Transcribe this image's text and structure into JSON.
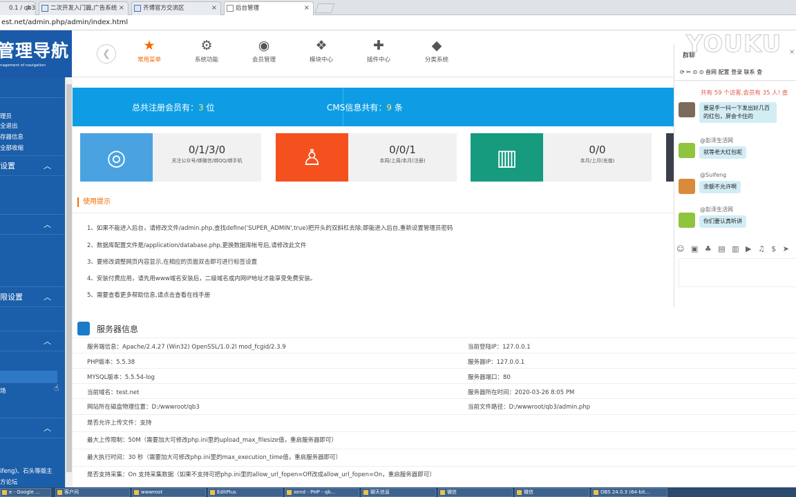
{
  "browser": {
    "tabs": [
      {
        "label": "0.1 / qb3"
      },
      {
        "label": "二次开发入门篇,广告系统"
      },
      {
        "label": "齐博官方交流区"
      },
      {
        "label": "后台管理"
      }
    ],
    "address": "est.net/admin.php/admin/index.html"
  },
  "brand": {
    "title": "管理导航",
    "subtitle": "nagement of navigation"
  },
  "topnav": [
    {
      "label": "常用菜单",
      "icon": "star-icon"
    },
    {
      "label": "系统功能",
      "icon": "gear-icon"
    },
    {
      "label": "会员管理",
      "icon": "user-icon"
    },
    {
      "label": "模块中心",
      "icon": "cubes-icon"
    },
    {
      "label": "插件中心",
      "icon": "puzzle-icon"
    },
    {
      "label": "分类系统",
      "icon": "tags-icon"
    }
  ],
  "sidebar": {
    "links": [
      "理员",
      "全退出",
      "存器信息",
      "全部收缩"
    ],
    "sections": [
      "设置",
      "",
      "限设置",
      "",
      ""
    ],
    "items": [
      "场"
    ],
    "footer": [
      "ifeng)、石头等版主",
      "方论坛"
    ]
  },
  "stats": {
    "members_pre": "总共注册会员有：",
    "members_val": "3",
    "members_unit": "位",
    "cms_pre": "CMS信息共有：",
    "cms_val": "9",
    "cms_unit": "条"
  },
  "cards": [
    {
      "value": "0/1/3/0",
      "label": "关注公众号/绑微信/绑QQ/绑手机",
      "color": "#4aa3e0",
      "icon": "user-circle-icon"
    },
    {
      "value": "0/0/1",
      "label": "本周/上周/本月(注册)",
      "color": "#f4511e",
      "icon": "person-icon"
    },
    {
      "value": "0/0",
      "label": "本月/上月(充值)",
      "color": "#169b7e",
      "icon": "bar-chart-icon"
    }
  ],
  "tips": {
    "title": "使用提示",
    "items": [
      "1、如果不能进入后台，请修改文件/admin.php,查找define('SUPER_ADMIN',true)把开头的双斜杠去除;即能进入后台,重新设置管理员密码",
      "2、数据库配置文件是/application/database.php,更换数据库帐号后,请修改此文件",
      "3、要修改调整网页内容显示,在相应的页面双击即可进行标签设置",
      "4、安装付费应用，请先用www域名安装后，二级域名或内网IP地址才能享受免费安装。",
      "5、需要查看更多帮助信息,请点击查看在线手册"
    ]
  },
  "server": {
    "title": "服务器信息",
    "rows": [
      [
        "服务端信息：Apache/2.4.27 (Win32) OpenSSL/1.0.2l mod_fcgid/2.3.9",
        "当前登陆IP：127.0.0.1"
      ],
      [
        "PHP版本：5.5.38",
        "服务器IP：127.0.0.1"
      ],
      [
        "MYSQL版本：5.5.54-log",
        "服务器端口：80"
      ],
      [
        "当前域名：test.net",
        "服务器所在时间：2020-03-26 8:05 PM"
      ],
      [
        "网站所在磁盘物理位置：D:/wwwroot/qb3",
        "当前文件路径：D:/wwwroot/qb3/admin.php"
      ],
      [
        "是否允许上传文件：支持",
        ""
      ],
      [
        "最大上传限制：50M（需要加大可修改php.ini里的upload_max_filesize值，重启服务器即可）",
        ""
      ],
      [
        "最大执行时间：30 秒（需要加大可修改php.ini里的max_execution_time值，重启服务器即可）",
        ""
      ],
      [
        "是否支持采集：On 支持采集数据（如果不支持可把php.ini里的allow_url_fopen=Off改成allow_url_fopen=On，重启服务器即可）",
        ""
      ]
    ]
  },
  "chat": {
    "title": "群聊",
    "toolbar": "⟳ ✂ ⊙ ⊙ 音网 配置 登录 联系 查",
    "notice": "共有 59 个访客,会员有 35 人! 查",
    "messages": [
      {
        "user": "",
        "text": "要是手一抖一下发出好几百的红包，屏会卡住的"
      },
      {
        "user": "@彭泽生活网",
        "text": "就等老大红包呢"
      },
      {
        "user": "@Suifeng",
        "text": "余额不允许啊"
      },
      {
        "user": "@彭泽生活网",
        "text": "你们要认真听讲"
      }
    ],
    "emoji_bar": "☺ ▣ ♣ ▤ ▥ ▶ ♫ $ ➤ ☎ ⌑ ✂"
  },
  "watermark": "YOUKU",
  "taskbar": [
    "e - Google ...",
    "客户间",
    "wwwroot",
    "EditPlus",
    "xend - PHP - qb...",
    "聊天信息",
    "微信",
    "微信",
    "OBS 24.0.3 (64-bit..."
  ]
}
